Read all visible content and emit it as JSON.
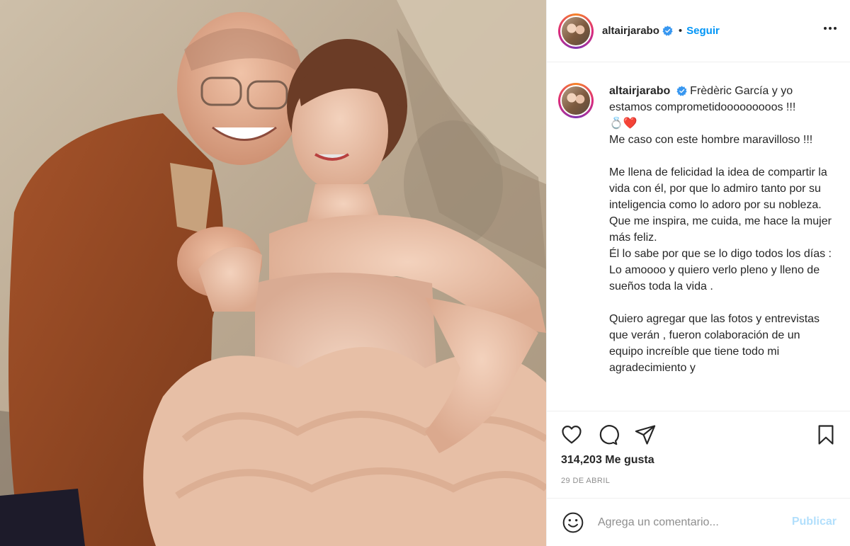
{
  "post": {
    "username": "altairjarabo",
    "separator": "•",
    "follow_label": "Seguir",
    "more_icon": "more-options-icon"
  },
  "caption": {
    "username": "altairjarabo",
    "lines": [
      "Frèdèric García y yo estamos comprometidooooooooos !!!",
      "💍❤️",
      "Me caso con este hombre maravilloso !!!",
      "",
      "Me llena de felicidad la idea de compartir la vida con él, por que lo admiro tanto por su inteligencia como lo adoro por su nobleza. Que me inspira, me cuida, me hace la mujer más feliz.",
      "Él lo sabe por que se lo digo todos los días : Lo amoooo y quiero verlo pleno y lleno de sueños toda la vida .",
      "",
      "Quiero agregar que las fotos y entrevistas que verán , fueron colaboración de un equipo increíble que tiene todo mi agradecimiento y"
    ]
  },
  "stats": {
    "likes_count": "314,203",
    "likes_label": "Me gusta",
    "date": "29 DE ABRIL"
  },
  "comment": {
    "placeholder": "Agrega un comentario...",
    "publish_label": "Publicar"
  },
  "colors": {
    "accent": "#0095f6",
    "publish_disabled": "#b2dffc",
    "muted": "#8e8e8e",
    "text": "#262626",
    "border": "#efefef"
  }
}
